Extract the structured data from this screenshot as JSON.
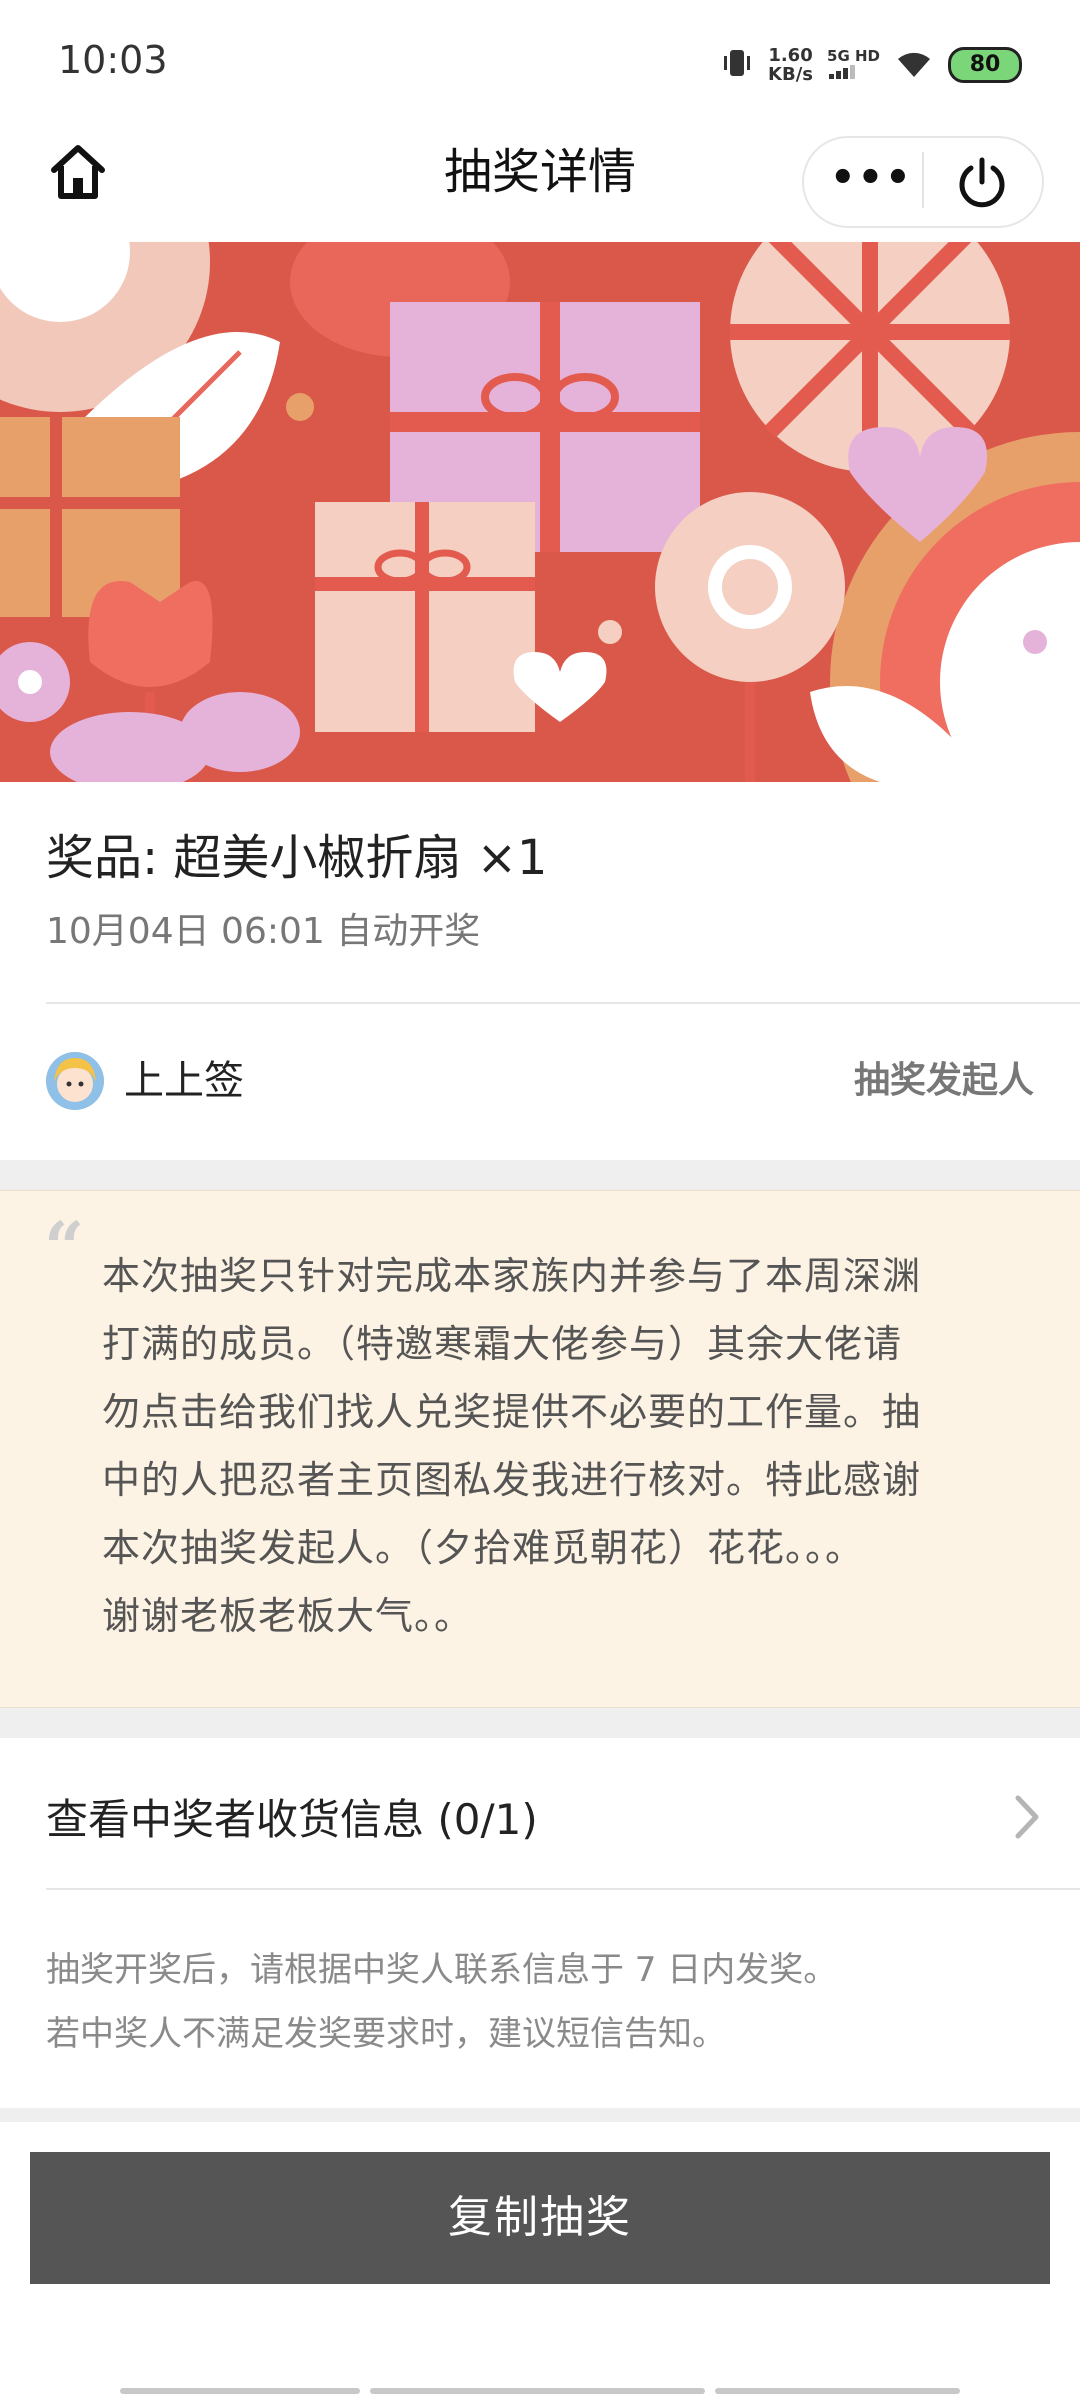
{
  "status_bar": {
    "time": "10:03",
    "speed_value": "1.60",
    "speed_unit": "KB/s",
    "network": "5G HD",
    "battery": "80"
  },
  "nav": {
    "title": "抽奖详情",
    "more": "•••"
  },
  "prize": {
    "title": "奖品: 超美小椒折扇 ×1",
    "draw_time": "10月04日 06:01 自动开奖"
  },
  "host": {
    "name": "上上签",
    "role": "抽奖发起人"
  },
  "note": {
    "quote_mark": "“",
    "lines": [
      "本次抽奖只针对完成本家族内并参与了本周深渊",
      "打满的成员。（特邀寒霜大佬参与）其余大佬请",
      "勿点击给我们找人兑奖提供不必要的工作量。抽",
      "中的人把忍者主页图私发我进行核对。特此感谢",
      "本次抽奖发起人。（夕拾难觅朝花）花花。。。",
      "谢谢老板老板大气。。"
    ]
  },
  "winner_info": {
    "label": "查看中奖者收货信息 (0/1)"
  },
  "tips": {
    "line1": "抽奖开奖后，请根据中奖人联系信息于 7 日内发奖。",
    "line2": "若中奖人不满足发奖要求时，建议短信告知。"
  },
  "actions": {
    "copy": "复制抽奖"
  },
  "colors": {
    "banner_red": "#d9584a",
    "note_bg": "#fdf3e4",
    "button_bg": "#555555"
  }
}
